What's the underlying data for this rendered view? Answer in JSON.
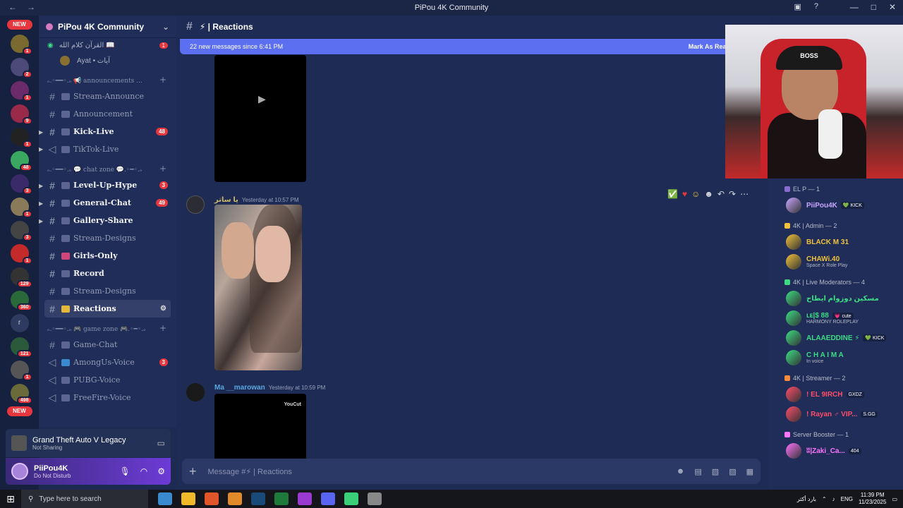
{
  "window": {
    "title": "PiPou 4K Community"
  },
  "servers": {
    "new_top": "NEW",
    "new_bottom": "NEW",
    "letter": "r",
    "badges": [
      "1",
      "2",
      "1",
      "9",
      "1",
      "48",
      "3",
      "1",
      "3",
      "1",
      "129",
      "360",
      "121",
      "1",
      "498"
    ]
  },
  "sidebar": {
    "server_name": "PiPou 4K Community",
    "voice_top": {
      "label": "القرآن كلام الله 📖",
      "badge": "1"
    },
    "voice_user": "Ayat • آيات",
    "categories": {
      "announcements": "ₒ.◦━━◦.ₒ 📢 announcements ...",
      "chat": "ₒ.◦━━◦.ₒ 💬 chat zone 💬.◦━◦.ₒ",
      "game": "ₒ.◦━━◦.ₒ 🎮 game zone 🎮.◦━◦.ₒ"
    },
    "items": [
      {
        "label": "Stream-Announce",
        "badge": ""
      },
      {
        "label": "Announcement",
        "badge": ""
      },
      {
        "label": "Kick-Live",
        "badge": "48"
      },
      {
        "label": "TikTok-Live",
        "badge": ""
      },
      {
        "label": "Level-Up-Hype",
        "badge": "3"
      },
      {
        "label": "General-Chat",
        "badge": "49"
      },
      {
        "label": "Gallery-Share",
        "badge": ""
      },
      {
        "label": "Stream-Designs",
        "badge": ""
      },
      {
        "label": "Girls-Only",
        "badge": ""
      },
      {
        "label": "Record",
        "badge": ""
      },
      {
        "label": "Stream-Designs",
        "badge": ""
      },
      {
        "label": "Reactions",
        "badge": ""
      },
      {
        "label": "Game-Chat",
        "badge": ""
      },
      {
        "label": "AmongUs-Voice",
        "badge": "3"
      },
      {
        "label": "PUBG-Voice",
        "badge": ""
      },
      {
        "label": "FreeFire-Voice",
        "badge": ""
      }
    ]
  },
  "activity": {
    "game": "Grand Theft Auto V Legacy",
    "status": "Not Sharing"
  },
  "user": {
    "name": "PiiPou4K",
    "status": "Do Not Disturb"
  },
  "channel": {
    "title": "⚡ | Reactions"
  },
  "banner": {
    "text": "22 new messages since 6:41 PM",
    "mark": "Mark As Read"
  },
  "messages": [
    {
      "author": "يا ساتر",
      "time": "Yesterday at 10:57 PM"
    },
    {
      "author": "Ma __marowan",
      "time": "Yesterday at 10:59 PM",
      "video_label": "YouCut"
    }
  ],
  "composer": {
    "placeholder": "Message #⚡ | Reactions"
  },
  "members": {
    "groups": [
      {
        "title": "EL P — 1",
        "color": "#8a6bd1",
        "members": [
          {
            "name": "PiiPou4K",
            "tag": "💚 KICK",
            "status": "",
            "color": "#c9a7ff"
          }
        ]
      },
      {
        "title": "4K | Admin — 2",
        "color": "#f0c23b",
        "members": [
          {
            "name": "BLACK M 31",
            "tag": "",
            "status": "",
            "color": "#f0c23b"
          },
          {
            "name": "CHAWi.40",
            "tag": "",
            "status": "Space X Role Play",
            "color": "#f0c23b"
          }
        ]
      },
      {
        "title": "4K | Live Moderators — 4",
        "color": "#3ddc84",
        "members": [
          {
            "name": "مسكين دوزوام ايطاح",
            "tag": "",
            "status": "",
            "color": "#3ddc84"
          },
          {
            "name": "ʟᴇ|$ 88",
            "tag": "💗 cute",
            "status": "HARMONY ROLEPLAY",
            "color": "#3ddc84"
          },
          {
            "name": "ALAAEDDINE ⚡",
            "tag": "💚 KICK",
            "status": "",
            "color": "#3ddc84"
          },
          {
            "name": "C H A I M A",
            "tag": "",
            "status": "In voice",
            "color": "#3ddc84"
          }
        ]
      },
      {
        "title": "4K | Streamer — 2",
        "color": "#ff8a3d",
        "members": [
          {
            "name": "! EL 9IRCH",
            "tag": "GXDZ",
            "status": "",
            "color": "#ff4d6a"
          },
          {
            "name": "! Rayan ♂ VIP...",
            "tag": "S.GG",
            "status": "",
            "color": "#ff4d6a"
          }
        ]
      },
      {
        "title": "Server Booster — 1",
        "color": "#ff73fa",
        "members": [
          {
            "name": "ʬ|Zaki_Ca...",
            "tag": "404",
            "status": "",
            "color": "#ff73fa"
          }
        ]
      }
    ]
  },
  "taskbar": {
    "search": "Type here to search",
    "weather": "بارد أكثر",
    "lang": "ENG",
    "time": "11:39 PM",
    "date": "11/23/2025"
  }
}
